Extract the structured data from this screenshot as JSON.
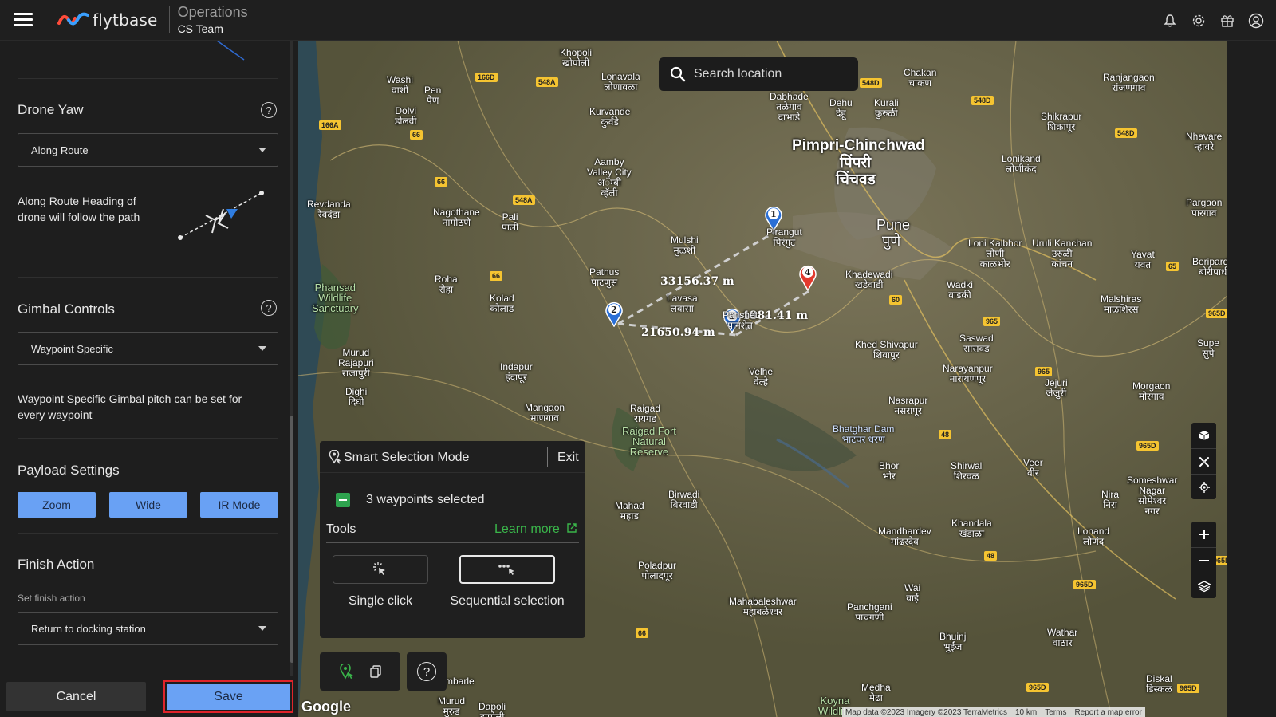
{
  "header": {
    "logo_text": "flytbase",
    "org_title": "Operations",
    "team_name": "CS Team"
  },
  "sidebar": {
    "drone_yaw": {
      "title": "Drone Yaw",
      "value": "Along Route",
      "description_line1": "Along Route Heading of",
      "description_line2": "drone will follow the path"
    },
    "gimbal": {
      "title": "Gimbal Controls",
      "value": "Waypoint Specific",
      "description_line1": "Waypoint Specific Gimbal pitch can be set for",
      "description_line2": "every waypoint"
    },
    "payload": {
      "title": "Payload Settings",
      "buttons": [
        "Zoom",
        "Wide",
        "IR Mode"
      ]
    },
    "finish": {
      "title": "Finish Action",
      "label": "Set finish action",
      "value": "Return to docking station"
    },
    "cancel_label": "Cancel",
    "save_label": "Save"
  },
  "map": {
    "search_placeholder": "Search location",
    "distances": [
      "33156.37 m",
      "21650.94 m",
      "4881.41 m"
    ],
    "waypoints": [
      "1",
      "2",
      "3",
      "4"
    ],
    "places": {
      "pimpri1": "Pimpri-Chinchwad",
      "pimpri2": "पिंपरी",
      "pimpri3": "चिंचवड",
      "pune1": "Pune",
      "pune2": "पुणे",
      "khopoli": "Khopoli\nखोपोली",
      "lonavala": "Lonavala\nलोणावळा",
      "chakan": "Chakan\nचाकण",
      "dehu": "Dehu\nदेहू",
      "kurali": "Kurali\nकुरुळी",
      "talegaon": "Talegaon\nDabhade\nतळेगाव\nदाभाडे",
      "kurvande": "Kurvande\nकुर्वंडे",
      "aamby": "Aamby\nValley City\nअॅम्बी\nव्हॅली",
      "washi": "Washi\nवाशी",
      "pen": "Pen\nपेण",
      "dolvi": "Dolvi\nडोलवी",
      "nagothane": "Nagothane\nनागोठणे",
      "pali": "Pali\nपाली",
      "revdanda": "Revdanda\nरेवदंडा",
      "mulshi": "Mulshi\nमुळशी",
      "patnus": "Patnus\nपाटणुस",
      "roha": "Roha\nरोहा",
      "kolad": "Kolad\nकोलाड",
      "lavasa": "Lavasa\nलवासा",
      "pirangut": "Pirangut\nपिरंगुट",
      "khadewadi": "Khadewadi\nखडेवाडी",
      "lonikalbhor": "Loni Kalbhor\nलोणी\nकाळभोर",
      "urulikanchan": "Uruli Kanchan\nउरुळी\nकांचन",
      "yavat": "Yavat\nयवत",
      "boripardhi": "Boripardhi\nबोरीपार्धी",
      "wadki": "Wadki\nवाडकी",
      "malshiras": "Malshiras\nमाळशिरस",
      "shikrapur": "Shikrapur\nशिक्रापूर",
      "ranjangaon": "Ranjangaon\nरांजणगाव",
      "lonikand": "Lonikand\nलोणीकंद",
      "nhavare": "Nhavare\nन्हावरे",
      "pargaon": "Pargaon\nपारगाव",
      "phansad": "Phansad\nWildlife\nSanctuary",
      "murud": "Murud\nRajapuri\nराजापुरी",
      "indapur": "Indapur\nइंदापूर",
      "mangaon": "Mangaon\nमाणगाव",
      "dighi": "Dighi\nदिघी",
      "raigad": "Raigad\nरायगड",
      "raigadfort": "Raigad Fort\nNatural\nReserve",
      "velhe": "Velhe\nवेल्हे",
      "khedshivapur": "Khed Shivapur\nशिवापूर",
      "saswad": "Saswad\nसासवड",
      "narayanpur": "Narayanpur\nनारायणपूर",
      "jejuri": "Jejuri\nजेजुरी",
      "morgaon": "Morgaon\nमोरगाव",
      "supe": "Supe\nसुपे",
      "nasrapur": "Nasrapur\nनसरापूर",
      "bhatghar": "Bhatghar Dam\nभाटघर धरण",
      "bhor": "Bhor\nभोर",
      "shirwal": "Shirwal\nशिरवळ",
      "veer": "Veer\nवीर",
      "nira": "Nira\nनिरा",
      "someshwar": "Someshwar\nNagar\nसोमेश्वर\nनगर",
      "khandala": "Khandala\nखंडाळा",
      "mandhardev": "Mandhardev\nमांढरदेव",
      "lonand": "Lonand\nलोणंद",
      "mahad": "Mahad\nमहाड",
      "birwadi": "Birwadi\nबिरवाडी",
      "poladpur": "Poladpur\nपोलादपूर",
      "mahabaleshwar": "Mahabaleshwar\nमहाबळेश्वर",
      "panchgani": "Panchgani\nपाचगणी",
      "wai": "Wai\nवाई",
      "bhuinj": "Bhuinj\nभुईंज",
      "wathar": "Wathar\nवाठार",
      "diskal": "Diskal\nडिस्कळ",
      "medha": "Medha\nमेढा",
      "koyna": "Koyna\nWildlife",
      "ambarle": "Ambarle",
      "dapoli": "Dapoli\nदापोली",
      "murud2": "Murud\nमुरुड",
      "panshet": "Panshet\nपानशेत"
    },
    "shields": [
      "166D",
      "548A",
      "166A",
      "66",
      "66",
      "548A",
      "66",
      "548D",
      "548D",
      "548D",
      "60",
      "65",
      "965",
      "965",
      "965D",
      "48",
      "965D",
      "48",
      "965D",
      "965D",
      "66",
      "965D",
      "965D"
    ],
    "google_label": "Google",
    "attribution": {
      "map_data": "Map data ©2023 Imagery ©2023 TerraMetrics",
      "scale": "10 km",
      "terms": "Terms",
      "report": "Report a map error"
    }
  },
  "smart_selection": {
    "title": "Smart Selection Mode",
    "exit_label": "Exit",
    "selected_text": "3 waypoints selected",
    "tools_label": "Tools",
    "learn_more": "Learn more",
    "single_click": "Single click",
    "sequential": "Sequential selection"
  }
}
